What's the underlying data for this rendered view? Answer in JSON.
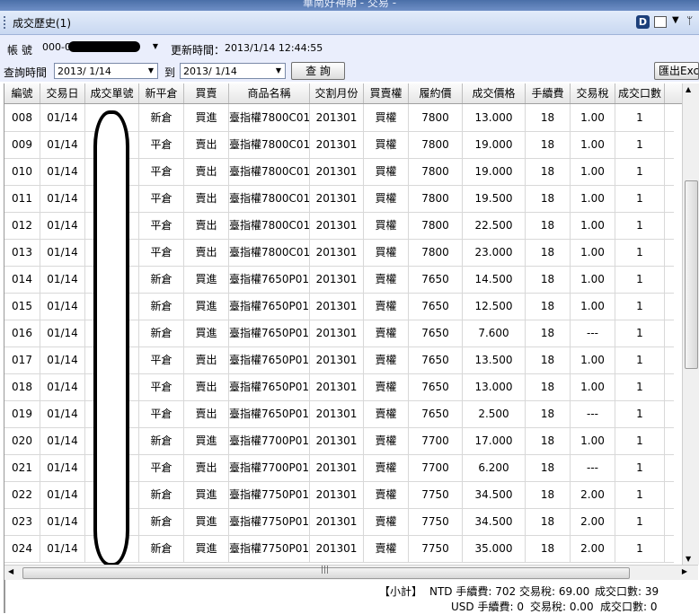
{
  "window": {
    "title": "華南好神期 - 交易 -"
  },
  "panel": {
    "title": "成交歷史(1)",
    "d_button": "D"
  },
  "account": {
    "label": "帳 號",
    "value": "000-0",
    "update_label": "更新時間：",
    "update_time": "2013/1/14 12:44:55"
  },
  "query": {
    "label": "查詢時間",
    "from": "2013/ 1/14",
    "to_label": "到",
    "to": "2013/ 1/14",
    "button": "查 詢",
    "export": "匯出Excel"
  },
  "columns": [
    "編號",
    "交易日",
    "成交單號",
    "新平倉",
    "買賣",
    "商品名稱",
    "交割月份",
    "買賣權",
    "履約價",
    "成交價格",
    "手續費",
    "交易稅",
    "成交口數"
  ],
  "rows": [
    [
      "008",
      "01/14",
      "",
      "新倉",
      "買進",
      "臺指權7800C01",
      "201301",
      "買權",
      "7800",
      "13.000",
      "18",
      "1.00",
      "1"
    ],
    [
      "009",
      "01/14",
      "",
      "平倉",
      "賣出",
      "臺指權7800C01",
      "201301",
      "買權",
      "7800",
      "19.000",
      "18",
      "1.00",
      "1"
    ],
    [
      "010",
      "01/14",
      "",
      "平倉",
      "賣出",
      "臺指權7800C01",
      "201301",
      "買權",
      "7800",
      "19.000",
      "18",
      "1.00",
      "1"
    ],
    [
      "011",
      "01/14",
      "",
      "平倉",
      "賣出",
      "臺指權7800C01",
      "201301",
      "買權",
      "7800",
      "19.500",
      "18",
      "1.00",
      "1"
    ],
    [
      "012",
      "01/14",
      "",
      "平倉",
      "賣出",
      "臺指權7800C01",
      "201301",
      "買權",
      "7800",
      "22.500",
      "18",
      "1.00",
      "1"
    ],
    [
      "013",
      "01/14",
      "",
      "平倉",
      "賣出",
      "臺指權7800C01",
      "201301",
      "買權",
      "7800",
      "23.000",
      "18",
      "1.00",
      "1"
    ],
    [
      "014",
      "01/14",
      "",
      "新倉",
      "買進",
      "臺指權7650P01",
      "201301",
      "賣權",
      "7650",
      "14.500",
      "18",
      "1.00",
      "1"
    ],
    [
      "015",
      "01/14",
      "",
      "新倉",
      "買進",
      "臺指權7650P01",
      "201301",
      "賣權",
      "7650",
      "12.500",
      "18",
      "1.00",
      "1"
    ],
    [
      "016",
      "01/14",
      "",
      "新倉",
      "買進",
      "臺指權7650P01",
      "201301",
      "賣權",
      "7650",
      "7.600",
      "18",
      "---",
      "1"
    ],
    [
      "017",
      "01/14",
      "",
      "平倉",
      "賣出",
      "臺指權7650P01",
      "201301",
      "賣權",
      "7650",
      "13.500",
      "18",
      "1.00",
      "1"
    ],
    [
      "018",
      "01/14",
      "",
      "平倉",
      "賣出",
      "臺指權7650P01",
      "201301",
      "賣權",
      "7650",
      "13.000",
      "18",
      "1.00",
      "1"
    ],
    [
      "019",
      "01/14",
      "",
      "平倉",
      "賣出",
      "臺指權7650P01",
      "201301",
      "賣權",
      "7650",
      "2.500",
      "18",
      "---",
      "1"
    ],
    [
      "020",
      "01/14",
      "",
      "新倉",
      "買進",
      "臺指權7700P01",
      "201301",
      "賣權",
      "7700",
      "17.000",
      "18",
      "1.00",
      "1"
    ],
    [
      "021",
      "01/14",
      "",
      "平倉",
      "賣出",
      "臺指權7700P01",
      "201301",
      "賣權",
      "7700",
      "6.200",
      "18",
      "---",
      "1"
    ],
    [
      "022",
      "01/14",
      "",
      "新倉",
      "買進",
      "臺指權7750P01",
      "201301",
      "賣權",
      "7750",
      "34.500",
      "18",
      "2.00",
      "1"
    ],
    [
      "023",
      "01/14",
      "",
      "新倉",
      "買進",
      "臺指權7750P01",
      "201301",
      "賣權",
      "7750",
      "34.500",
      "18",
      "2.00",
      "1"
    ],
    [
      "024",
      "01/14",
      "",
      "新倉",
      "買進",
      "臺指權7750P01",
      "201301",
      "賣權",
      "7750",
      "35.000",
      "18",
      "2.00",
      "1"
    ]
  ],
  "summary": {
    "label": "【小計】",
    "ntd_fee": "NTD 手續費: 702",
    "ntd_tax": "交易稅: 69.00",
    "ntd_qty": "成交口數: 39",
    "usd_fee": "USD 手續費: 0",
    "usd_tax": "交易稅: 0.00",
    "usd_qty": "成交口數: 0"
  }
}
